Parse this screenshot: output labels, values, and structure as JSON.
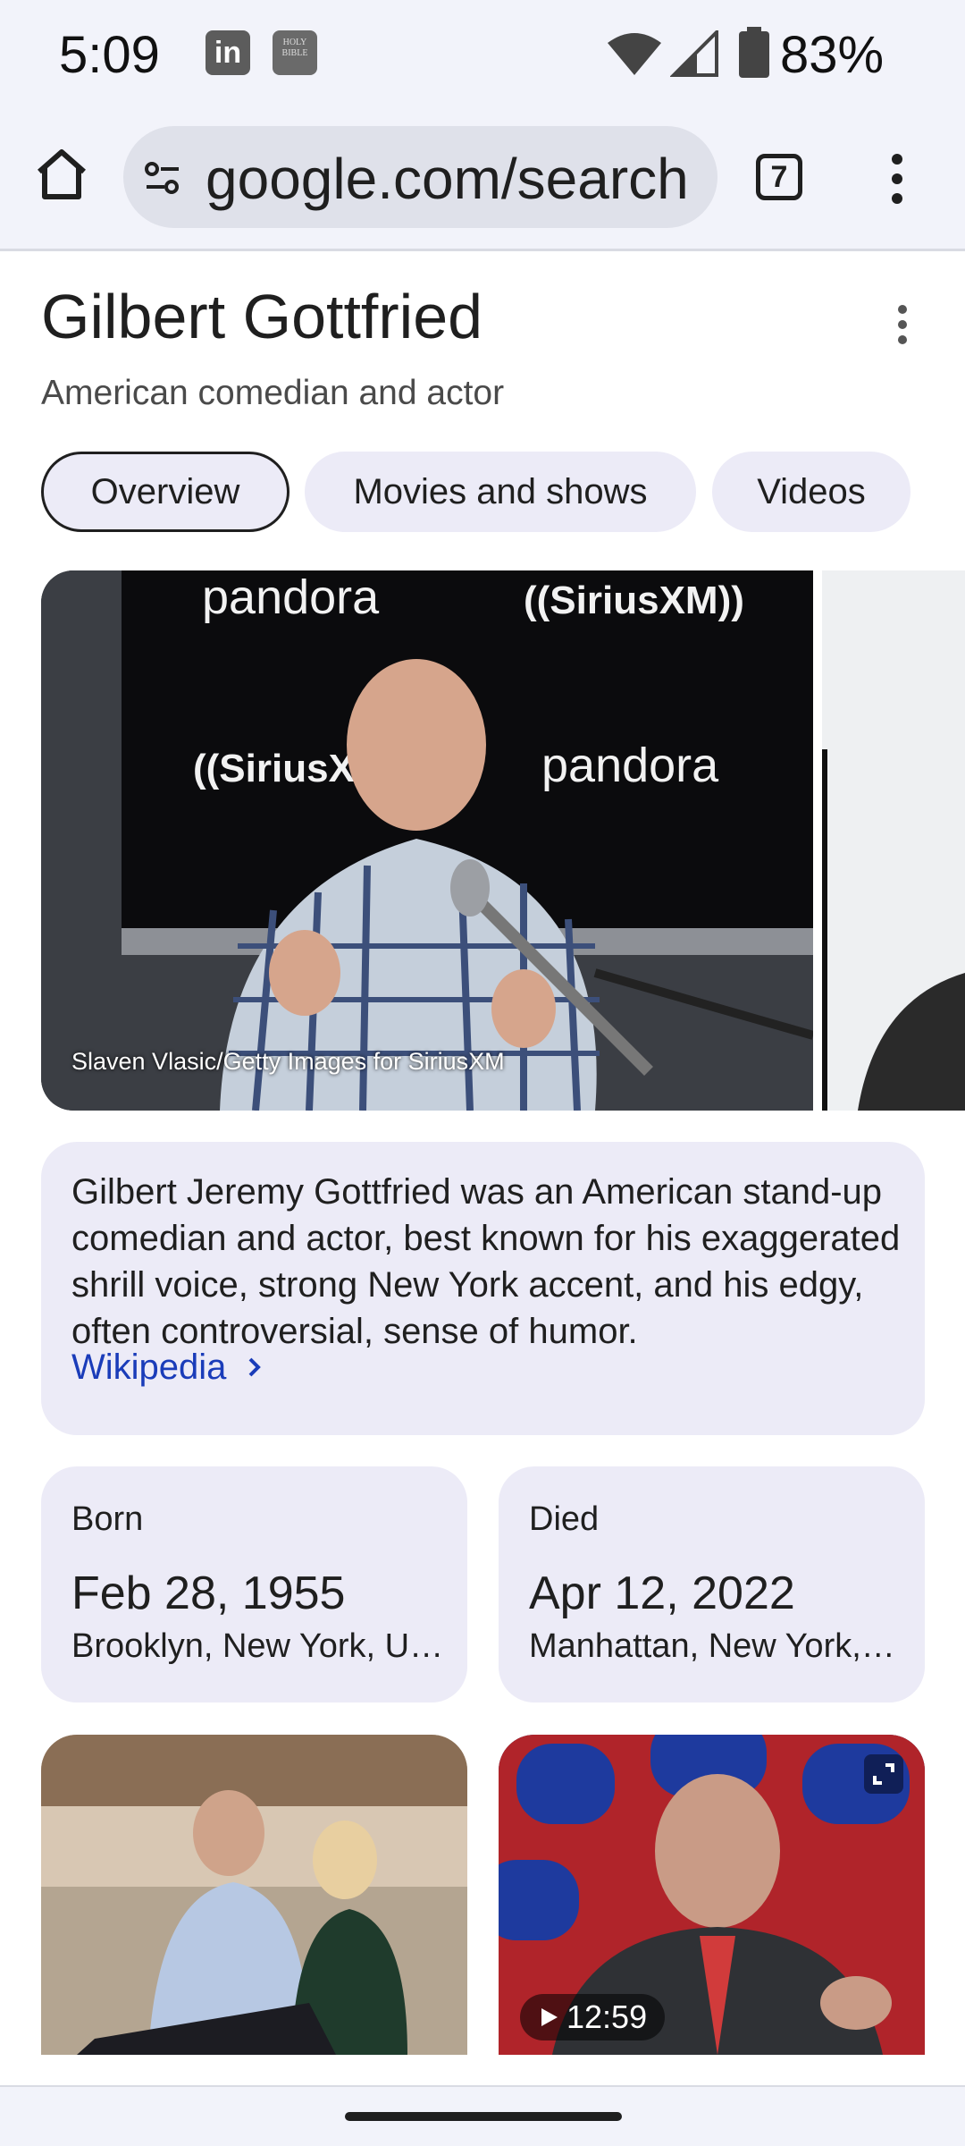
{
  "status_bar": {
    "time": "5:09",
    "battery": "83%",
    "icons": [
      "linkedin-icon",
      "bible-app-icon",
      "wifi-icon",
      "cell-signal-icon",
      "battery-icon"
    ]
  },
  "browser": {
    "url": "google.com/search",
    "tab_count": "7"
  },
  "knowledge_panel": {
    "title": "Gilbert Gottfried",
    "subtitle": "American comedian and actor",
    "chips": [
      {
        "label": "Overview",
        "active": true
      },
      {
        "label": "Movies and shows",
        "active": false
      },
      {
        "label": "Videos",
        "active": false
      }
    ],
    "hero_image": {
      "credit": "Slaven Vlasic/Getty Images for SiriusXM",
      "sign_text_1": "pandora",
      "sign_text_2": "((SiriusXM))"
    },
    "description": {
      "text": "Gilbert Jeremy Gottfried was an American stand-up comedian and actor, best known for his exaggerated shrill voice, strong New York accent, and his edgy, often controversial, sense of humor.",
      "source_link": "Wikipedia"
    },
    "facts": {
      "born": {
        "label": "Born",
        "date": "Feb 28, 1955",
        "place": "Brooklyn, New York, United States"
      },
      "died": {
        "label": "Died",
        "date": "Apr 12, 2022",
        "place": "Manhattan, New York, United States"
      }
    },
    "media": [
      {
        "type": "image"
      },
      {
        "type": "video",
        "duration": "12:59"
      }
    ]
  },
  "colors": {
    "chrome_bg": "#f2f3fa",
    "card_bg": "#ecebf7",
    "link": "#1a3cb9",
    "text": "#1f1f1f"
  }
}
